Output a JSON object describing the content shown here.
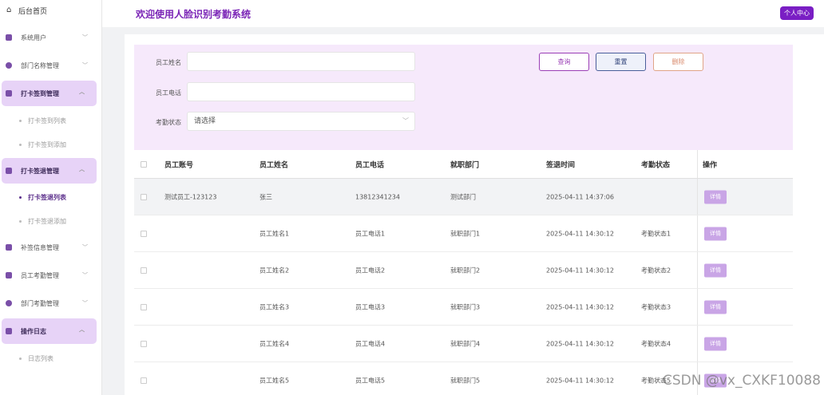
{
  "app_title": "欢迎使用人脸识别考勤系统",
  "personal_center": "个人中心",
  "sidebar": {
    "home": "后台首页",
    "items": [
      {
        "label": "系统用户",
        "icon": "user-icon"
      },
      {
        "label": "部门名称管理",
        "icon": "gear-icon"
      },
      {
        "label": "打卡签到管理",
        "icon": "document-icon",
        "active": true,
        "sub": [
          {
            "label": "打卡签到列表"
          },
          {
            "label": "打卡签到添加"
          }
        ]
      },
      {
        "label": "打卡签退管理",
        "icon": "trash-icon",
        "active": true,
        "sub": [
          {
            "label": "打卡签退列表",
            "active": true
          },
          {
            "label": "打卡签退添加"
          }
        ]
      },
      {
        "label": "补签信息管理",
        "icon": "edit-icon"
      },
      {
        "label": "员工考勤管理",
        "icon": "book-icon"
      },
      {
        "label": "部门考勤管理",
        "icon": "gear-icon"
      },
      {
        "label": "操作日志",
        "icon": "list-icon",
        "active": true,
        "sub": [
          {
            "label": "日志列表"
          }
        ]
      }
    ]
  },
  "search": {
    "name_label": "员工姓名",
    "name_value": "",
    "phone_label": "员工电话",
    "phone_value": "",
    "status_label": "考勤状态",
    "status_placeholder": "请选择",
    "query_button": "查询",
    "reset_button": "重置",
    "delete_button": "删除"
  },
  "table": {
    "headers": [
      "员工账号",
      "员工姓名",
      "员工电话",
      "就职部门",
      "签退时间",
      "考勤状态",
      "操作"
    ],
    "detail_label": "详情",
    "rows": [
      {
        "account": "测试员工-123123",
        "name": "张三",
        "phone": "13812341234",
        "dept": "测试部门",
        "time": "2025-04-11 14:37:06",
        "status": ""
      },
      {
        "account": "",
        "name": "员工姓名1",
        "phone": "员工电话1",
        "dept": "就职部门1",
        "time": "2025-04-11 14:30:12",
        "status": "考勤状态1"
      },
      {
        "account": "",
        "name": "员工姓名2",
        "phone": "员工电话2",
        "dept": "就职部门2",
        "time": "2025-04-11 14:30:12",
        "status": "考勤状态2"
      },
      {
        "account": "",
        "name": "员工姓名3",
        "phone": "员工电话3",
        "dept": "就职部门3",
        "time": "2025-04-11 14:30:12",
        "status": "考勤状态3"
      },
      {
        "account": "",
        "name": "员工姓名4",
        "phone": "员工电话4",
        "dept": "就职部门4",
        "time": "2025-04-11 14:30:12",
        "status": "考勤状态4"
      },
      {
        "account": "",
        "name": "员工姓名5",
        "phone": "员工电话5",
        "dept": "就职部门5",
        "time": "2025-04-11 14:30:12",
        "status": "考勤状态5"
      }
    ]
  },
  "watermark": "CSDN @vx_CXKF10088"
}
